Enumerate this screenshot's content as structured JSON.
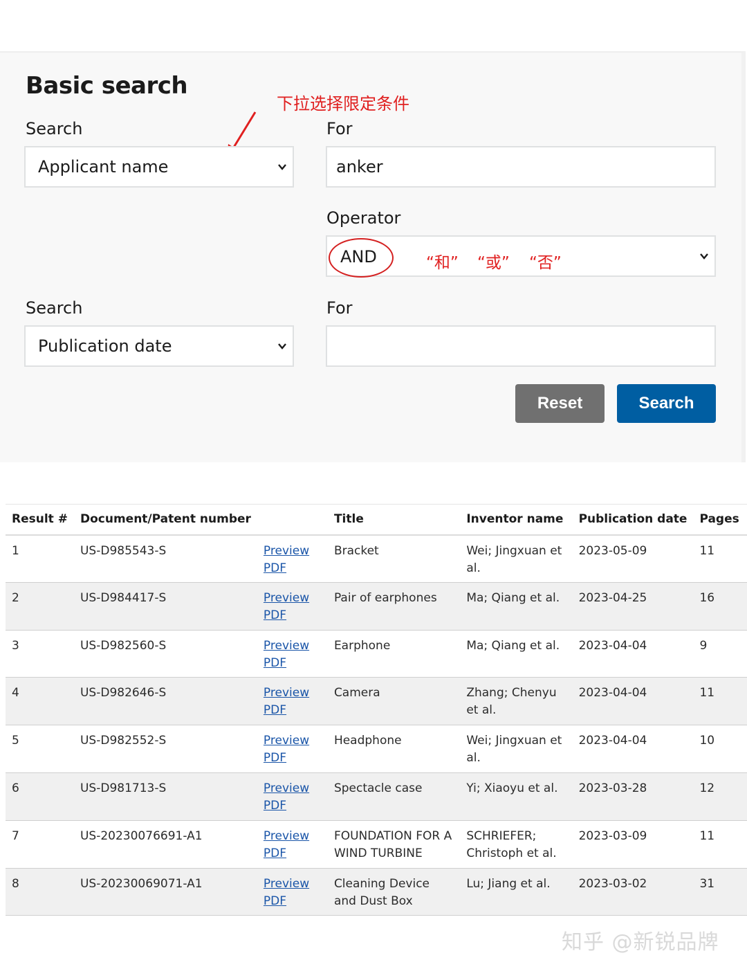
{
  "form": {
    "title": "Basic search",
    "row1": {
      "search_label": "Search",
      "search_value": "Applicant name",
      "for_label": "For",
      "for_value": "anker"
    },
    "operator": {
      "label": "Operator",
      "value": "AND"
    },
    "row2": {
      "search_label": "Search",
      "search_value": "Publication date",
      "for_label": "For",
      "for_value": ""
    },
    "buttons": {
      "reset": "Reset",
      "search": "Search"
    },
    "colors": {
      "reset": "#707070",
      "search": "#005ea2",
      "annotation": "#e02020"
    }
  },
  "annotations": {
    "dropdown_hint": "下拉选择限定条件",
    "op_and": "“和”",
    "op_or": "“或”",
    "op_not": "“否”"
  },
  "table": {
    "headers": [
      "Result #",
      "Document/Patent number",
      "",
      "Title",
      "Inventor name",
      "Publication date",
      "Pages"
    ],
    "rows": [
      {
        "num": "1",
        "doc": "US-D985543-S",
        "preview": "Preview",
        "pdf": "PDF",
        "title": "Bracket",
        "inventor": "Wei; Jingxuan et al.",
        "date": "2023-05-09",
        "pages": "11"
      },
      {
        "num": "2",
        "doc": "US-D984417-S",
        "preview": "Preview",
        "pdf": "PDF",
        "title": "Pair of earphones",
        "inventor": "Ma; Qiang et al.",
        "date": "2023-04-25",
        "pages": "16"
      },
      {
        "num": "3",
        "doc": "US-D982560-S",
        "preview": "Preview",
        "pdf": "PDF",
        "title": "Earphone",
        "inventor": "Ma; Qiang et al.",
        "date": "2023-04-04",
        "pages": "9"
      },
      {
        "num": "4",
        "doc": "US-D982646-S",
        "preview": "Preview",
        "pdf": "PDF",
        "title": "Camera",
        "inventor": "Zhang; Chenyu et al.",
        "date": "2023-04-04",
        "pages": "11"
      },
      {
        "num": "5",
        "doc": "US-D982552-S",
        "preview": "Preview",
        "pdf": "PDF",
        "title": "Headphone",
        "inventor": "Wei; Jingxuan et al.",
        "date": "2023-04-04",
        "pages": "10"
      },
      {
        "num": "6",
        "doc": "US-D981713-S",
        "preview": "Preview",
        "pdf": "PDF",
        "title": "Spectacle case",
        "inventor": "Yi; Xiaoyu et al.",
        "date": "2023-03-28",
        "pages": "12"
      },
      {
        "num": "7",
        "doc": "US-20230076691-A1",
        "preview": "Preview",
        "pdf": "PDF",
        "title": "FOUNDATION FOR A WIND TURBINE",
        "inventor": "SCHRIEFER; Christoph et al.",
        "date": "2023-03-09",
        "pages": "11"
      },
      {
        "num": "8",
        "doc": "US-20230069071-A1",
        "preview": "Preview",
        "pdf": "PDF",
        "title": "Cleaning Device and Dust Box",
        "inventor": "Lu; Jiang et al.",
        "date": "2023-03-02",
        "pages": "31"
      }
    ]
  },
  "watermark": "知乎 @新锐品牌"
}
